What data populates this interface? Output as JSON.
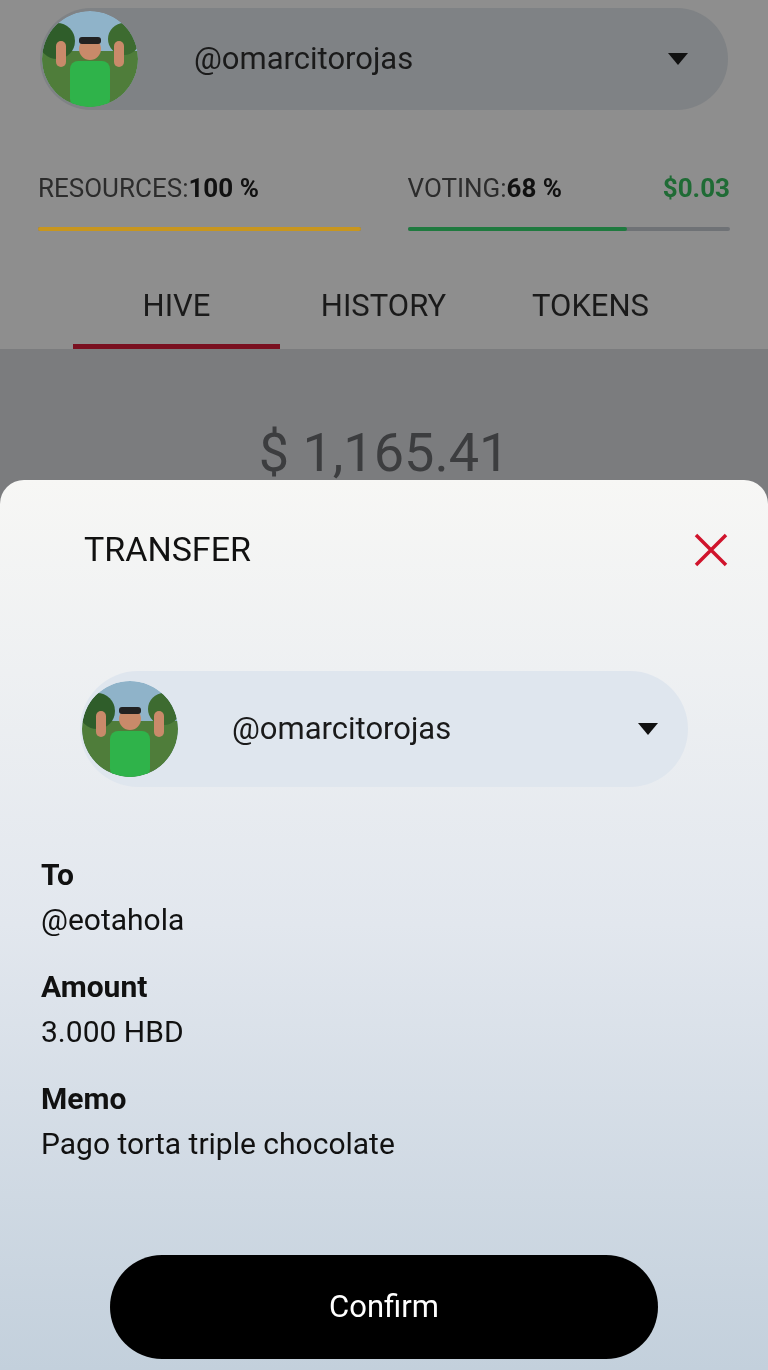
{
  "account": {
    "username": "@omarcitorojas"
  },
  "meters": [
    {
      "label": "RESOURCES:",
      "value": "100 %",
      "level": 1,
      "color": "#c8961e"
    },
    {
      "label": "VOTING:",
      "value": "68 %",
      "level": 0.68,
      "color": "#1f7a3f"
    }
  ],
  "vote_value": "$0.03",
  "tabs": [
    {
      "label": "HIVE",
      "selected": true
    },
    {
      "label": "HISTORY",
      "selected": false
    },
    {
      "label": "TOKENS",
      "selected": false
    }
  ],
  "balance": "$ 1,165.41",
  "transfer": {
    "title": "TRANSFER",
    "account": "@omarcitorojas",
    "fields": [
      {
        "label": "To",
        "value": "@eotahola"
      },
      {
        "label": "Amount",
        "value": "3.000 HBD"
      },
      {
        "label": "Memo",
        "value": "Pago torta triple chocolate"
      }
    ],
    "confirm": "Confirm"
  }
}
